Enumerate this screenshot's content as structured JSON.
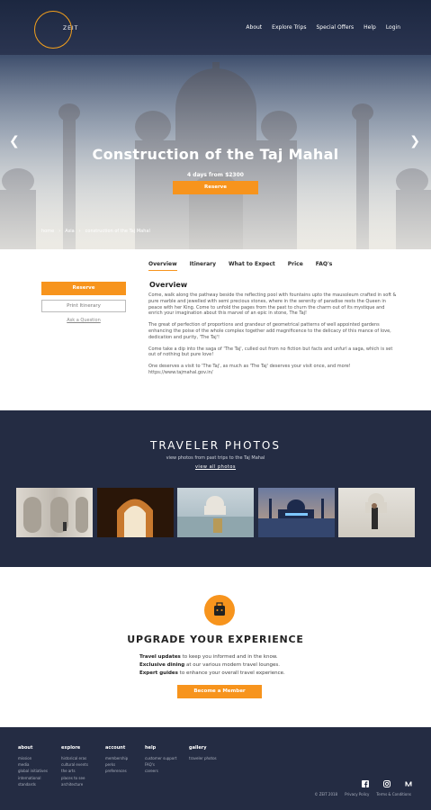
{
  "header": {
    "logo_text": "ZEIT",
    "nav": [
      "About",
      "Explore Trips",
      "Special Offers",
      "Help",
      "Login"
    ]
  },
  "hero": {
    "title": "Construction of the Taj Mahal",
    "subtitle": "4 days from $2300",
    "button": "Reserve",
    "breadcrumbs": [
      "home",
      "Asia",
      "construction of the Taj Mahal"
    ]
  },
  "sidebar": {
    "reserve": "Reserve",
    "print": "Print Itinerary",
    "ask": "Ask a Question"
  },
  "tabs": [
    "Overview",
    "Itinerary",
    "What to Expect",
    "Price",
    "FAQ's"
  ],
  "overview": {
    "title": "Overview",
    "paragraphs": [
      "Come, walk along the pathway beside the reflecting pool with fountains upto the mausoleum crafted in soft & pure marble and jewelled with semi precious stones, where in the serenity of paradise rests the Queen in peace with her King. Come to unfold the pages from the past to churn the charm out of its mystique and enrich your imagination about this marvel of an epic in stone, The Taj!",
      "The great of perfection of proportions and grandeur of geometrical patterns of well appointed gardens enhancing the poise of the whole complex together add magnificence to the delicacy of this mance of love, dedication and purity, 'The Taj'!",
      "Come take a dip into the saga of 'The Taj', culled out from no fiction but facts and unfurl a saga, which is set out of nothing but pure love!",
      "One deserves a visit to 'The Taj', as much as 'The Taj' deserves your visit once, and more! https://www.tajmahal.gov.in/"
    ]
  },
  "photos": {
    "title": "TRAVELER PHOTOS",
    "subtitle": "view photos from past trips to the Taj Mahal",
    "link": "view all photos"
  },
  "upgrade": {
    "title": "UPGRADE YOUR EXPERIENCE",
    "lines": [
      {
        "bold": "Travel updates",
        "rest": " to keep you informed and in the know."
      },
      {
        "bold": "Exclusive dining",
        "rest": " at our various modern travel lounges."
      },
      {
        "bold": "Expert guides",
        "rest": " to enhance your overall travel experience."
      }
    ],
    "button": "Become a Member"
  },
  "footer": {
    "columns": [
      {
        "heading": "about",
        "items": [
          "mission",
          "media",
          "global initiatives",
          "international",
          "standards"
        ]
      },
      {
        "heading": "explore",
        "items": [
          "historical eras",
          "cultural events",
          "the arts",
          "places to see",
          "architecture"
        ]
      },
      {
        "heading": "account",
        "items": [
          "membership",
          "perks",
          "preferences"
        ]
      },
      {
        "heading": "help",
        "items": [
          "customer support",
          "FAQ's",
          "careers"
        ]
      },
      {
        "heading": "gallery",
        "items": [
          "traveler photos"
        ]
      }
    ],
    "copyright": "© ZEIT 2018",
    "privacy": "Privacy Policy",
    "terms": "Terms & Conditions"
  }
}
